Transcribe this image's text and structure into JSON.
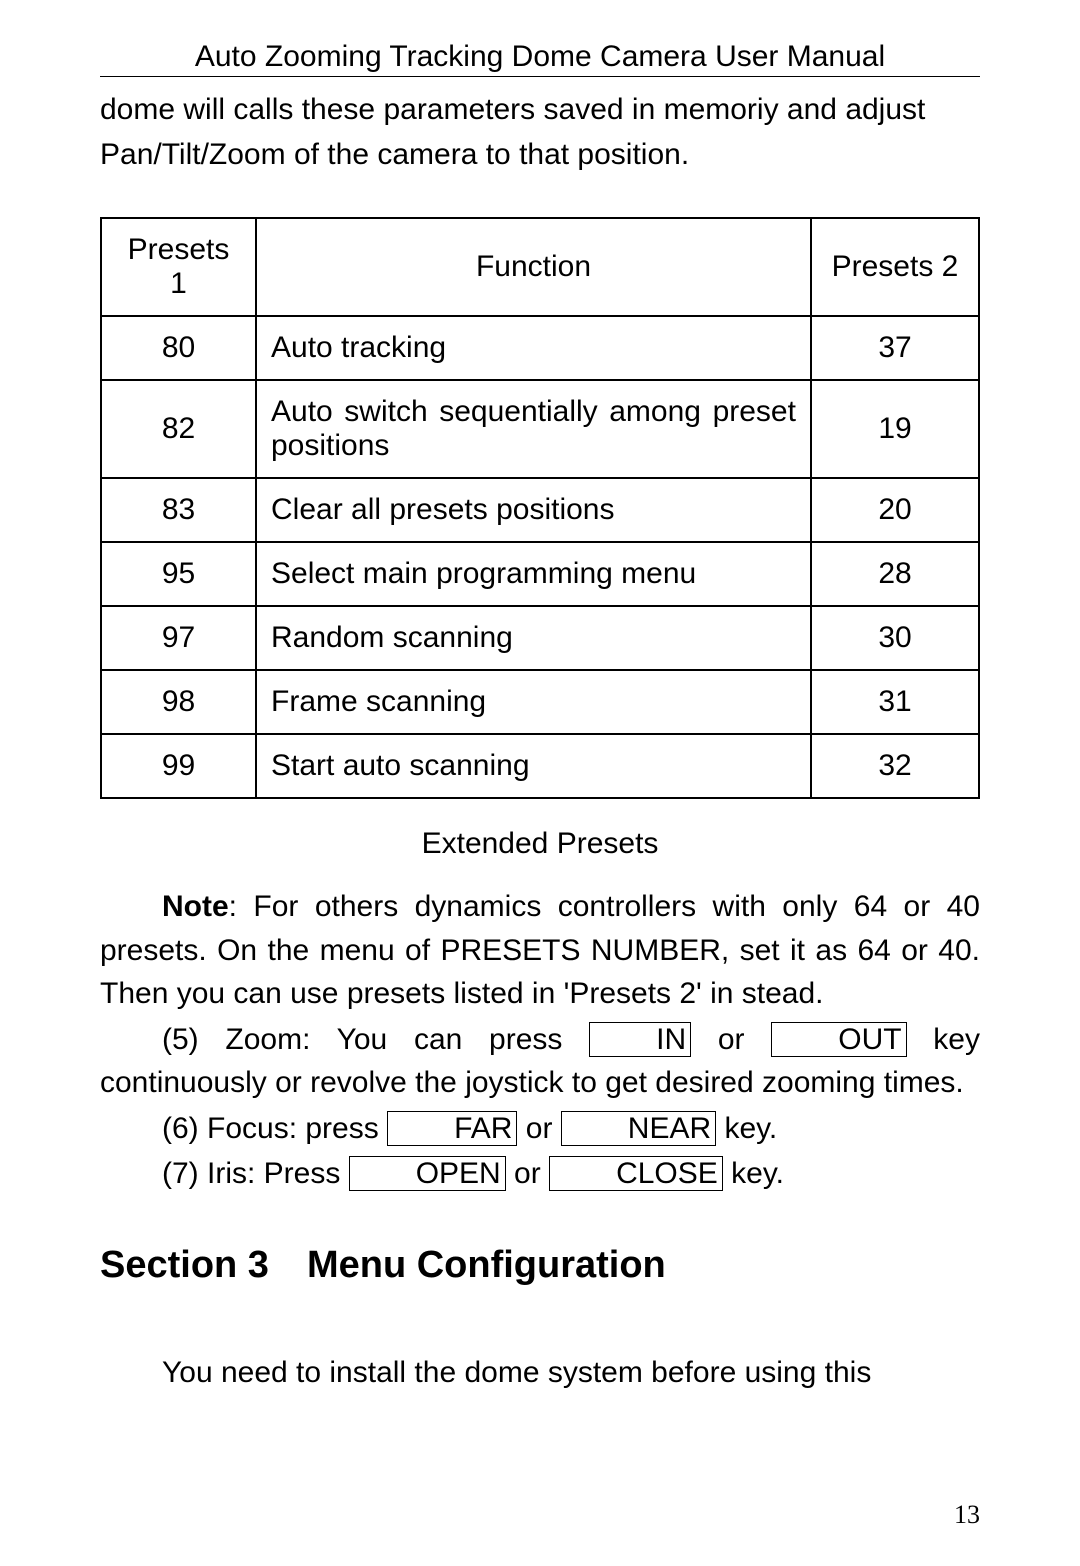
{
  "header": {
    "title": "Auto Zooming Tracking Dome Camera User Manual"
  },
  "intro": "dome will calls these parameters saved in memoriy and adjust Pan/Tilt/Zoom of the camera to that position.",
  "table": {
    "headers": {
      "p1": "Presets 1",
      "fn": "Function",
      "p2": "Presets 2"
    },
    "rows": [
      {
        "p1": "80",
        "fn": "Auto tracking",
        "p2": "37"
      },
      {
        "p1": "82",
        "fn_words": [
          "Auto",
          "switch",
          "sequentially",
          "among",
          "preset"
        ],
        "fn_tail": "positions",
        "p2": "19"
      },
      {
        "p1": "83",
        "fn": "Clear all presets positions",
        "p2": "20"
      },
      {
        "p1": "95",
        "fn": "Select main programming menu",
        "p2": "28"
      },
      {
        "p1": "97",
        "fn": "Random scanning",
        "p2": "30"
      },
      {
        "p1": "98",
        "fn": "Frame scanning",
        "p2": "31"
      },
      {
        "p1": "99",
        "fn": "Start auto scanning",
        "p2": "32"
      }
    ]
  },
  "caption": "Extended Presets",
  "note": {
    "label": "Note",
    "text": ": For others dynamics controllers with only 64 or 40 presets. On the menu of PRESETS NUMBER, set it as 64 or 40. Then you can use presets listed in 'Presets 2' in stead."
  },
  "step5": {
    "prefix": "(5) Zoom: You can press ",
    "key1": "IN",
    "mid": " or ",
    "key2": "OUT",
    "suffix": " key continuously or revolve the joystick to get desired zooming times."
  },
  "step6": {
    "prefix": "(6) Focus: press ",
    "key1": "FAR",
    "mid": " or ",
    "key2": "NEAR",
    "suffix": " key."
  },
  "step7": {
    "prefix": "(7) Iris: Press ",
    "key1": "OPEN",
    "mid": " or ",
    "key2": "CLOSE",
    "suffix": " key."
  },
  "section": {
    "title": "Section 3 Menu Configuration"
  },
  "section_intro": "You need to install the dome system before using this",
  "page_number": "13"
}
